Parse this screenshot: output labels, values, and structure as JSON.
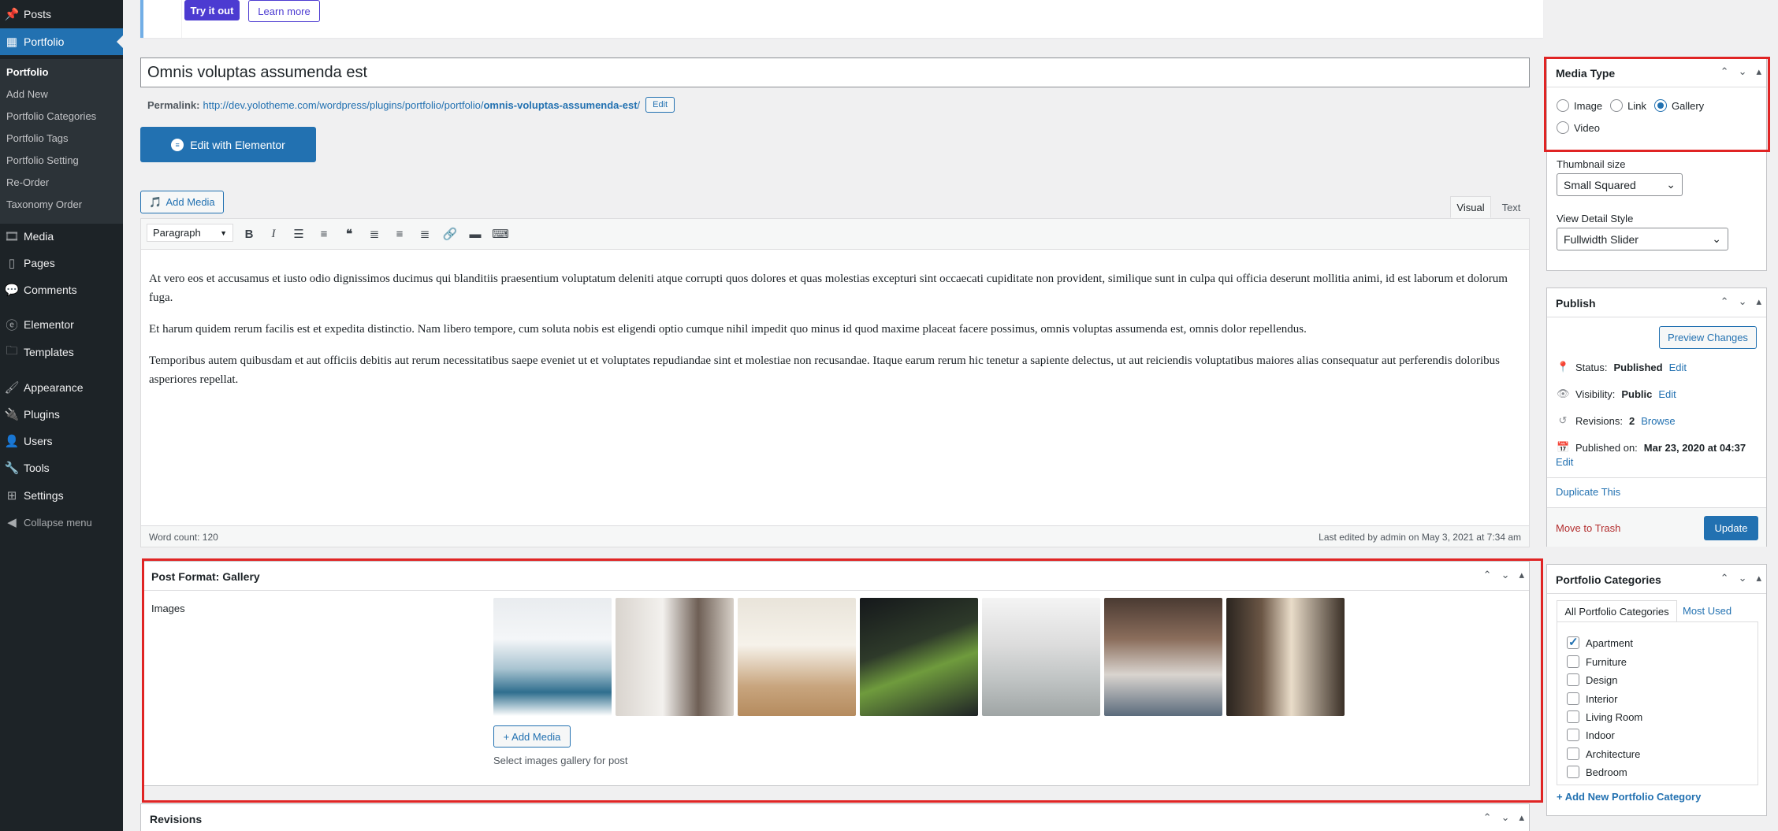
{
  "sidebar": {
    "posts": "Posts",
    "portfolio": "Portfolio",
    "sub": [
      "Portfolio",
      "Add New",
      "Portfolio Categories",
      "Portfolio Tags",
      "Portfolio Setting",
      "Re-Order",
      "Taxonomy Order"
    ],
    "media": "Media",
    "pages": "Pages",
    "comments": "Comments",
    "elementor": "Elementor",
    "templates": "Templates",
    "appearance": "Appearance",
    "plugins": "Plugins",
    "users": "Users",
    "tools": "Tools",
    "settings": "Settings",
    "collapse": "Collapse menu"
  },
  "notice": {
    "try_label": "Try it out",
    "learn_label": "Learn more"
  },
  "post": {
    "title": "Omnis voluptas assumenda est",
    "permalink_label": "Permalink:",
    "permalink_base": "http://dev.yolotheme.com/wordpress/plugins/portfolio/portfolio/",
    "permalink_slug": "omnis-voluptas-assumenda-est",
    "permalink_end": "/",
    "edit_label": "Edit",
    "elementor_label": "Edit with Elementor",
    "add_media_label": "Add Media"
  },
  "editor": {
    "tab_visual": "Visual",
    "tab_text": "Text",
    "format": "Paragraph",
    "paragraphs": [
      "At vero eos et accusamus et iusto odio dignissimos ducimus qui blanditiis praesentium voluptatum deleniti atque corrupti quos dolores et quas molestias excepturi sint occaecati cupiditate non provident, similique sunt in culpa qui officia deserunt mollitia animi, id est laborum et dolorum fuga.",
      "Et harum quidem rerum facilis est et expedita distinctio. Nam libero tempore, cum soluta nobis est eligendi optio cumque nihil impedit quo minus id quod maxime placeat facere possimus, omnis voluptas assumenda est, omnis dolor repellendus.",
      "Temporibus autem quibusdam et aut officiis debitis aut rerum necessitatibus saepe eveniet ut et voluptates repudiandae sint et molestiae non recusandae. Itaque earum rerum hic tenetur a sapiente delectus, ut aut reiciendis voluptatibus maiores alias consequatur aut perferendis doloribus asperiores repellat."
    ],
    "word_count": "Word count: 120",
    "last_edited": "Last edited by admin on May 3, 2021 at 7:34 am"
  },
  "gallery": {
    "title": "Post Format: Gallery",
    "images_label": "Images",
    "add_media_label": "+ Add Media",
    "hint": "Select images gallery for post"
  },
  "revisions": {
    "title": "Revisions"
  },
  "media_type": {
    "title": "Media Type",
    "options": [
      "Image",
      "Link",
      "Gallery",
      "Video"
    ],
    "selected": "Gallery",
    "thumb_label": "Thumbnail size",
    "thumb_value": "Small Squared",
    "detail_label": "View Detail Style",
    "detail_value": "Fullwidth Slider"
  },
  "publish": {
    "title": "Publish",
    "preview_label": "Preview Changes",
    "status_label": "Status:",
    "status_value": "Published",
    "visibility_label": "Visibility:",
    "visibility_value": "Public",
    "revisions_label": "Revisions:",
    "revisions_value": "2",
    "browse_label": "Browse",
    "published_label": "Published on:",
    "published_value": "Mar 23, 2020 at 04:37",
    "edit_label": "Edit",
    "duplicate_label": "Duplicate This",
    "trash_label": "Move to Trash",
    "update_label": "Update"
  },
  "categories": {
    "title": "Portfolio Categories",
    "tab_all": "All Portfolio Categories",
    "tab_used": "Most Used",
    "items": [
      "Apartment",
      "Furniture",
      "Design",
      "Interior",
      "Living Room",
      "Indoor",
      "Architecture",
      "Bedroom"
    ],
    "add_label": "+ Add New Portfolio Category"
  },
  "colors": {
    "admin_bar": "#1d2327",
    "accent": "#2271b1",
    "highlight": "#e02424",
    "notice_button": "#4c3bd1"
  }
}
